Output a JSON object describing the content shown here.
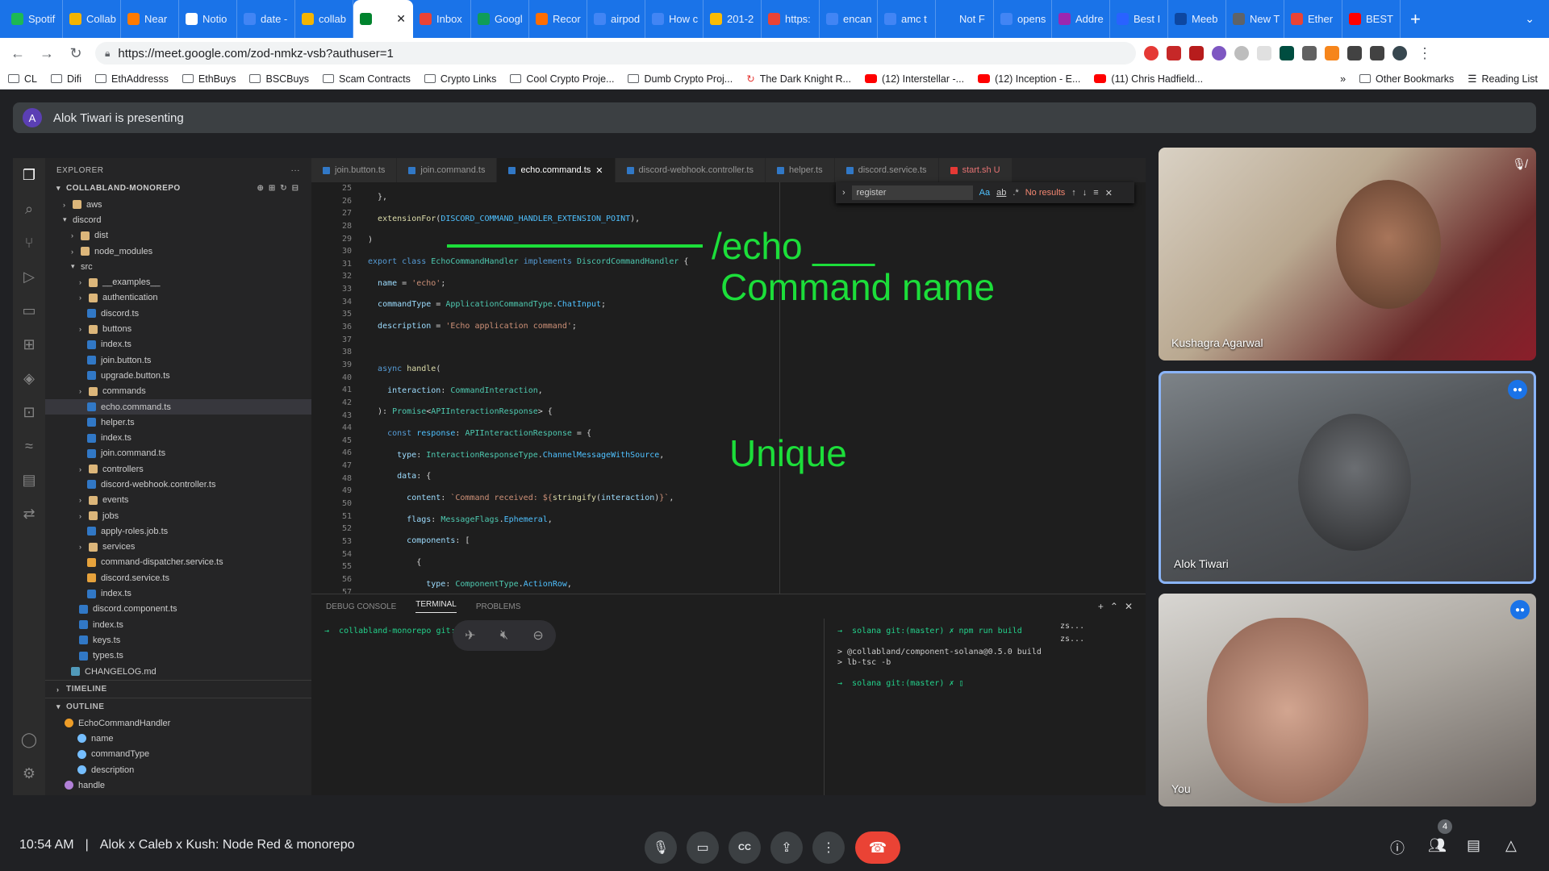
{
  "browser": {
    "tabs": [
      {
        "label": "Spotif",
        "color": "#1db954"
      },
      {
        "label": "Collab",
        "color": "#f4b400"
      },
      {
        "label": "Near",
        "color": "#ff7a00"
      },
      {
        "label": "Notio",
        "color": "#ffffff"
      },
      {
        "label": "date -",
        "color": "#4285f4"
      },
      {
        "label": "collab",
        "color": "#f4b400"
      },
      {
        "label": "",
        "color": "#00832d",
        "active": true
      },
      {
        "label": "Inbox",
        "color": "#ea4335"
      },
      {
        "label": "Googl",
        "color": "#0f9d58"
      },
      {
        "label": "Recor",
        "color": "#ff6d00"
      },
      {
        "label": "airpod",
        "color": "#4285f4"
      },
      {
        "label": "How c",
        "color": "#4285f4"
      },
      {
        "label": "201-2",
        "color": "#fbbc04"
      },
      {
        "label": "https:",
        "color": "#ea4335"
      },
      {
        "label": "encan",
        "color": "#4285f4"
      },
      {
        "label": "amc t",
        "color": "#4285f4"
      },
      {
        "label": "Not F",
        "color": "#1a73e8"
      },
      {
        "label": "opens",
        "color": "#4285f4"
      },
      {
        "label": "Addre",
        "color": "#9c27b0"
      },
      {
        "label": "Best I",
        "color": "#2962ff"
      },
      {
        "label": "Meeb",
        "color": "#0d47a1"
      },
      {
        "label": "New T",
        "color": "#5f6368"
      },
      {
        "label": "Ether",
        "color": "#ea4335"
      },
      {
        "label": "BEST",
        "color": "#ff0000"
      }
    ],
    "new_tab": "+",
    "url": "https://meet.google.com/zod-nmkz-vsb?authuser=1"
  },
  "bookmarks": {
    "items": [
      "CL",
      "Difi",
      "EthAddresss",
      "EthBuys",
      "BSCBuys",
      "Scam Contracts",
      "Crypto Links",
      "Cool Crypto Proje...",
      "Dumb Crypto Proj...",
      "The Dark Knight R...",
      "(12) Interstellar -...",
      "(12) Inception - E...",
      "(11) Chris Hadfield..."
    ],
    "overflow": "»",
    "other": "Other Bookmarks",
    "reading": "Reading List"
  },
  "presenting": {
    "avatar": "A",
    "text": "Alok Tiwari is presenting"
  },
  "vscode": {
    "explorer_title": "EXPLORER",
    "explorer_more": "···",
    "repo": "COLLABLAND-MONOREPO",
    "tree": [
      {
        "label": "aws",
        "indent": 1,
        "icon": "folder"
      },
      {
        "label": "discord",
        "indent": 1,
        "icon": "chev"
      },
      {
        "label": "dist",
        "indent": 2,
        "icon": "folder"
      },
      {
        "label": "node_modules",
        "indent": 2,
        "icon": "folder"
      },
      {
        "label": "src",
        "indent": 2,
        "icon": "chev"
      },
      {
        "label": "__examples__",
        "indent": 3,
        "icon": "folder"
      },
      {
        "label": "authentication",
        "indent": 3,
        "icon": "folder"
      },
      {
        "label": "discord.ts",
        "indent": 4,
        "icon": "ts"
      },
      {
        "label": "buttons",
        "indent": 3,
        "icon": "folder"
      },
      {
        "label": "index.ts",
        "indent": 4,
        "icon": "ts"
      },
      {
        "label": "join.button.ts",
        "indent": 4,
        "icon": "ts"
      },
      {
        "label": "upgrade.button.ts",
        "indent": 4,
        "icon": "ts"
      },
      {
        "label": "commands",
        "indent": 3,
        "icon": "folder"
      },
      {
        "label": "echo.command.ts",
        "indent": 4,
        "icon": "ts",
        "selected": true
      },
      {
        "label": "helper.ts",
        "indent": 4,
        "icon": "ts"
      },
      {
        "label": "index.ts",
        "indent": 4,
        "icon": "ts"
      },
      {
        "label": "join.command.ts",
        "indent": 4,
        "icon": "ts"
      },
      {
        "label": "controllers",
        "indent": 3,
        "icon": "folder"
      },
      {
        "label": "discord-webhook.controller.ts",
        "indent": 4,
        "icon": "ts"
      },
      {
        "label": "events",
        "indent": 3,
        "icon": "folder"
      },
      {
        "label": "jobs",
        "indent": 3,
        "icon": "folder"
      },
      {
        "label": "apply-roles.job.ts",
        "indent": 4,
        "icon": "ts"
      },
      {
        "label": "services",
        "indent": 3,
        "icon": "folder"
      },
      {
        "label": "command-dispatcher.service.ts",
        "indent": 4,
        "icon": "svc"
      },
      {
        "label": "discord.service.ts",
        "indent": 4,
        "icon": "svc"
      },
      {
        "label": "index.ts",
        "indent": 4,
        "icon": "ts"
      },
      {
        "label": "discord.component.ts",
        "indent": 3,
        "icon": "comp"
      },
      {
        "label": "index.ts",
        "indent": 3,
        "icon": "ts"
      },
      {
        "label": "keys.ts",
        "indent": 3,
        "icon": "ts"
      },
      {
        "label": "types.ts",
        "indent": 3,
        "icon": "ts"
      },
      {
        "label": "CHANGELOG.md",
        "indent": 2,
        "icon": "md"
      }
    ],
    "timeline": "TIMELINE",
    "outline": "OUTLINE",
    "outline_items": [
      "EchoCommandHandler",
      "name",
      "commandType",
      "description",
      "handle"
    ],
    "tabs": [
      "join.button.ts",
      "join.command.ts",
      "echo.command.ts",
      "discord-webhook.controller.ts",
      "helper.ts",
      "discord.service.ts",
      "start.sh U"
    ],
    "active_tab": "echo.command.ts",
    "line_numbers": [
      "25",
      "26",
      "27",
      "28",
      "29",
      "30",
      "31",
      "32",
      "33",
      "34",
      "35",
      "36",
      "37",
      "38",
      "39",
      "40",
      "41",
      "42",
      "43",
      "44",
      "45",
      "46",
      "47",
      "48",
      "49",
      "50",
      "51",
      "52",
      "53",
      "54",
      "55",
      "56",
      "57"
    ],
    "find": {
      "query": "register",
      "result": "No results",
      "opt1": "Aa",
      "opt2": "ab",
      "opt3": ".*"
    },
    "panel_tabs": [
      "DEBUG CONSOLE",
      "TERMINAL",
      "PROBLEMS"
    ],
    "terminal_left": "→  collabland-monorepo git:(master) ✗ ▯",
    "terminal_right": [
      "→  solana git:(master) ✗ npm run build",
      "",
      "> @collabland/component-solana@0.5.0 build",
      "> lb-tsc -b",
      "",
      "→  solana git:(master) ✗ ▯"
    ],
    "terminal_list": [
      "zs...",
      "zs..."
    ]
  },
  "annotations": {
    "echo": "/echo ___",
    "command_name": "Command name",
    "unique": "Unique"
  },
  "participants": [
    {
      "name": "Kushagra Agarwal",
      "muted": true
    },
    {
      "name": "Alok Tiwari",
      "speaking": true
    },
    {
      "name": "You",
      "speaking": true
    }
  ],
  "meeting": {
    "time": "10:54 AM",
    "separator": "|",
    "title": "Alok x Caleb x Kush: Node Red & monorepo",
    "people_count": "4"
  },
  "colors": {
    "accent": "#1a73e8",
    "end_call": "#ea4335",
    "annotation": "#1cde3a"
  }
}
